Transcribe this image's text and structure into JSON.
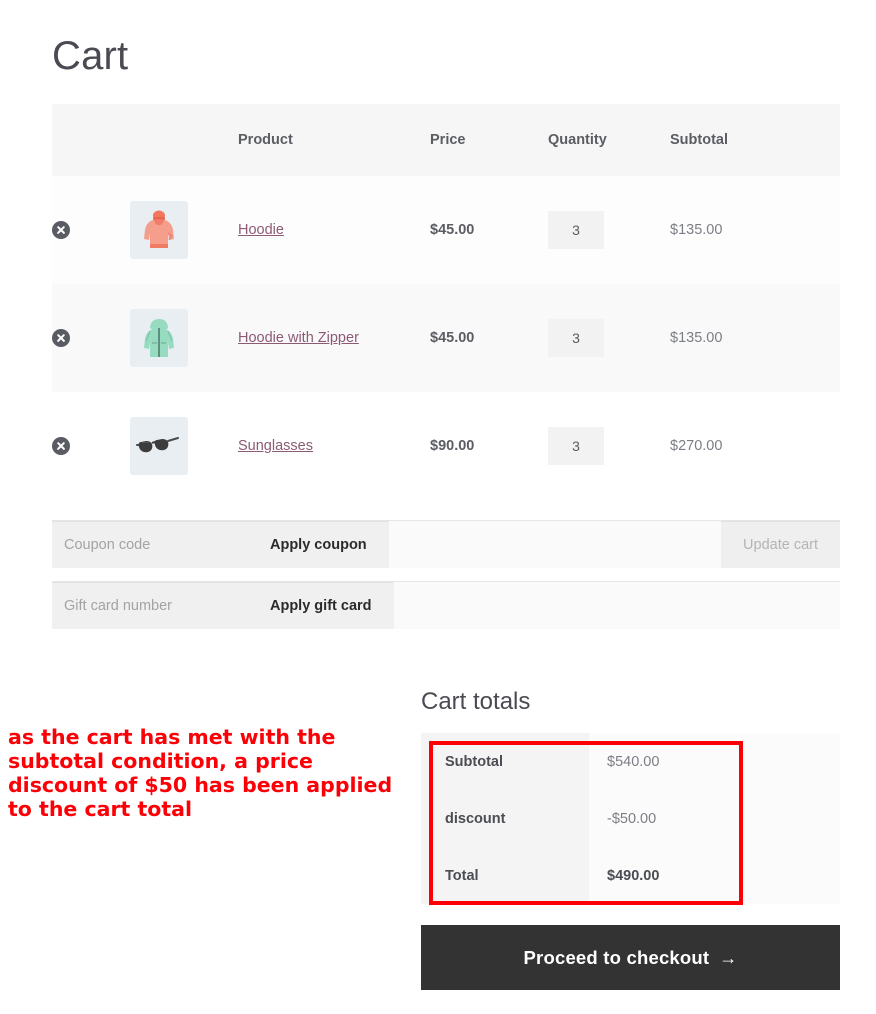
{
  "page": {
    "title": "Cart"
  },
  "cart_table": {
    "headers": {
      "remove": "",
      "thumbnail": "",
      "product": "Product",
      "price": "Price",
      "quantity": "Quantity",
      "subtotal": "Subtotal"
    },
    "items": [
      {
        "remove_icon": "remove-item-icon",
        "thumbnail_icon": "hoodie-thumbnail-icon",
        "name": "Hoodie",
        "price": "$45.00",
        "quantity": "3",
        "subtotal": "$135.00"
      },
      {
        "remove_icon": "remove-item-icon",
        "thumbnail_icon": "hoodie-with-zipper-thumbnail-icon",
        "name": "Hoodie with Zipper",
        "price": "$45.00",
        "quantity": "3",
        "subtotal": "$135.00"
      },
      {
        "remove_icon": "remove-item-icon",
        "thumbnail_icon": "sunglasses-thumbnail-icon",
        "name": "Sunglasses",
        "price": "$90.00",
        "quantity": "3",
        "subtotal": "$270.00"
      }
    ]
  },
  "coupon_row": {
    "input_placeholder": "Coupon code",
    "input_value": "",
    "apply_label": "Apply coupon",
    "update_cart_label": "Update cart"
  },
  "giftcard_row": {
    "input_placeholder": "Gift card number",
    "input_value": "",
    "apply_label": "Apply gift card"
  },
  "annotation": {
    "text": "as the cart has met with the subtotal condition, a price discount of $50 has been applied to the cart total",
    "color": "#fb0007"
  },
  "cart_totals": {
    "heading": "Cart totals",
    "rows": [
      {
        "label": "Subtotal",
        "value": "$540.00"
      },
      {
        "label": "discount",
        "value": "-$50.00"
      },
      {
        "label": "Total",
        "value": "$490.00"
      }
    ],
    "highlight_color": "#fb0007"
  },
  "checkout": {
    "label": "Proceed to checkout",
    "arrow_icon": "→",
    "background_color": "#333333"
  }
}
